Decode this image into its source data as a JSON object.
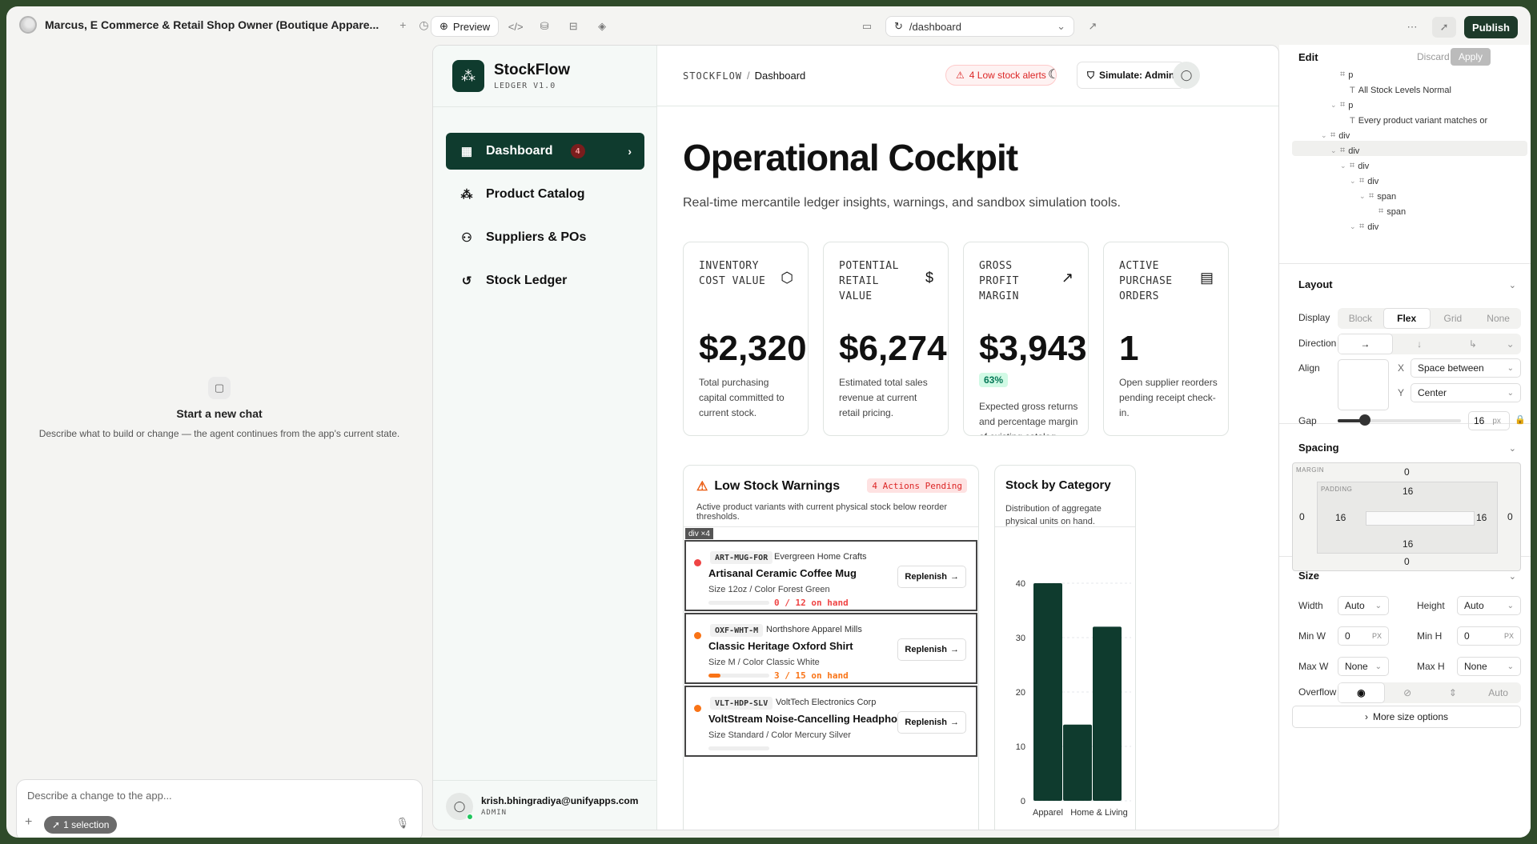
{
  "topbar": {
    "project_title": "Marcus, E Commerce & Retail Shop Owner (Boutique Appare...",
    "preview_label": "Preview",
    "url": "/dashboard",
    "publish_label": "Publish"
  },
  "chat": {
    "empty_title": "Start a new chat",
    "empty_desc": "Describe what to build or change — the agent continues from the app's current state.",
    "input_placeholder": "Describe a change to the app...",
    "selection_label": "1 selection"
  },
  "app": {
    "brand_name": "StockFlow",
    "brand_version": "LEDGER V1.0",
    "nav": [
      {
        "label": "Dashboard",
        "badge": "4",
        "active": true
      },
      {
        "label": "Product Catalog"
      },
      {
        "label": "Suppliers & POs"
      },
      {
        "label": "Stock Ledger"
      }
    ],
    "user_email": "krish.bhingradiya@unifyapps.com",
    "user_role": "ADMIN",
    "breadcrumb_root": "STOCKFLOW",
    "breadcrumb_sep": "/",
    "breadcrumb_page": "Dashboard",
    "alert_label": "4 Low stock alerts",
    "simulate_label": "Simulate: Admin",
    "title": "Operational Cockpit",
    "subtitle": "Real-time mercantile ledger insights, warnings, and sandbox simulation tools.",
    "kpis": [
      {
        "label": "INVENTORY COST VALUE",
        "value": "$2,320",
        "desc": "Total purchasing capital committed to current stock."
      },
      {
        "label": "POTENTIAL RETAIL VALUE",
        "value": "$6,274",
        "desc": "Estimated total sales revenue at current retail pricing."
      },
      {
        "label": "GROSS PROFIT MARGIN",
        "value": "$3,943",
        "badge": "63%",
        "desc": "Expected gross returns and percentage margin of existing catalog."
      },
      {
        "label": "ACTIVE PURCHASE ORDERS",
        "value": "1",
        "desc": "Open supplier reorders pending receipt check-in."
      }
    ],
    "warnings": {
      "title": "Low Stock Warnings",
      "pending": "4 Actions Pending",
      "subtitle": "Active product variants with current physical stock below reorder thresholds.",
      "tag": "div ×4",
      "replenish_label": "Replenish",
      "items": [
        {
          "sku": "ART-MUG-FOR",
          "vendor": "Evergreen Home Crafts",
          "name": "Artisanal Ceramic Coffee Mug",
          "variant": "Size 12oz / Color Forest Green",
          "stock": "0 / 12 on hand",
          "level": 0,
          "color": "#ef4444"
        },
        {
          "sku": "OXF-WHT-M",
          "vendor": "Northshore Apparel Mills",
          "name": "Classic Heritage Oxford Shirt",
          "variant": "Size M / Color Classic White",
          "stock": "3 / 15 on hand",
          "level": 0.2,
          "color": "#f97316"
        },
        {
          "sku": "VLT-HDP-SLV",
          "vendor": "VoltTech Electronics Corp",
          "name": "VoltStream Noise-Cancelling Headphones",
          "variant": "Size Standard / Color Mercury Silver",
          "stock": "",
          "level": 0,
          "color": "#f97316"
        }
      ]
    },
    "category": {
      "title": "Stock by Category",
      "subtitle": "Distribution of aggregate physical units on hand."
    }
  },
  "chart_data": {
    "type": "bar",
    "title": "Stock by Category",
    "categories": [
      "Apparel",
      "",
      "Home & Living"
    ],
    "values": [
      40,
      14,
      32
    ],
    "yticks": [
      0,
      10,
      20,
      30,
      40
    ],
    "ylim": [
      0,
      40
    ],
    "color": "#0f3b2e"
  },
  "edit": {
    "title": "Edit",
    "discard": "Discard",
    "apply": "Apply",
    "tree": [
      {
        "label": "p",
        "depth": 4,
        "kind": "el",
        "caret": ""
      },
      {
        "label": "All Stock Levels Normal",
        "depth": 5,
        "kind": "text",
        "caret": ""
      },
      {
        "label": "p",
        "depth": 4,
        "kind": "el",
        "caret": "v"
      },
      {
        "label": "Every product variant matches or",
        "depth": 5,
        "kind": "text",
        "caret": ""
      },
      {
        "label": "div",
        "depth": 3,
        "kind": "el",
        "caret": "v"
      },
      {
        "label": "div",
        "depth": 4,
        "kind": "el",
        "caret": "v"
      },
      {
        "label": "div",
        "depth": 5,
        "kind": "el",
        "caret": "v"
      },
      {
        "label": "div",
        "depth": 6,
        "kind": "el",
        "caret": "v"
      },
      {
        "label": "span",
        "depth": 7,
        "kind": "el",
        "caret": "v"
      },
      {
        "label": "span",
        "depth": 8,
        "kind": "el",
        "caret": ""
      },
      {
        "label": "div",
        "depth": 6,
        "kind": "el",
        "caret": "v"
      }
    ],
    "layout": {
      "title": "Layout",
      "display_label": "Display",
      "display_options": [
        "Block",
        "Flex",
        "Grid",
        "None"
      ],
      "display_selected": "Flex",
      "direction_label": "Direction",
      "align_label": "Align",
      "x_label": "X",
      "x_value": "Space between",
      "y_label": "Y",
      "y_value": "Center",
      "gap_label": "Gap",
      "gap_value": "16",
      "gap_unit": "px"
    },
    "spacing": {
      "title": "Spacing",
      "margin_label": "MARGIN",
      "padding_label": "PADDING",
      "margin": {
        "top": "0",
        "right": "0",
        "bottom": "0",
        "left": "0"
      },
      "padding": {
        "top": "16",
        "right": "16",
        "bottom": "16",
        "left": "16"
      }
    },
    "size": {
      "title": "Size",
      "width_label": "Width",
      "width_value": "Auto",
      "height_label": "Height",
      "height_value": "Auto",
      "minw_label": "Min W",
      "minw_value": "0",
      "minw_unit": "PX",
      "minh_label": "Min H",
      "minh_value": "0",
      "minh_unit": "PX",
      "maxw_label": "Max W",
      "maxw_value": "None",
      "maxh_label": "Max H",
      "maxh_value": "None",
      "overflow_label": "Overflow",
      "overflow_auto": "Auto",
      "more_label": "More size options"
    }
  }
}
